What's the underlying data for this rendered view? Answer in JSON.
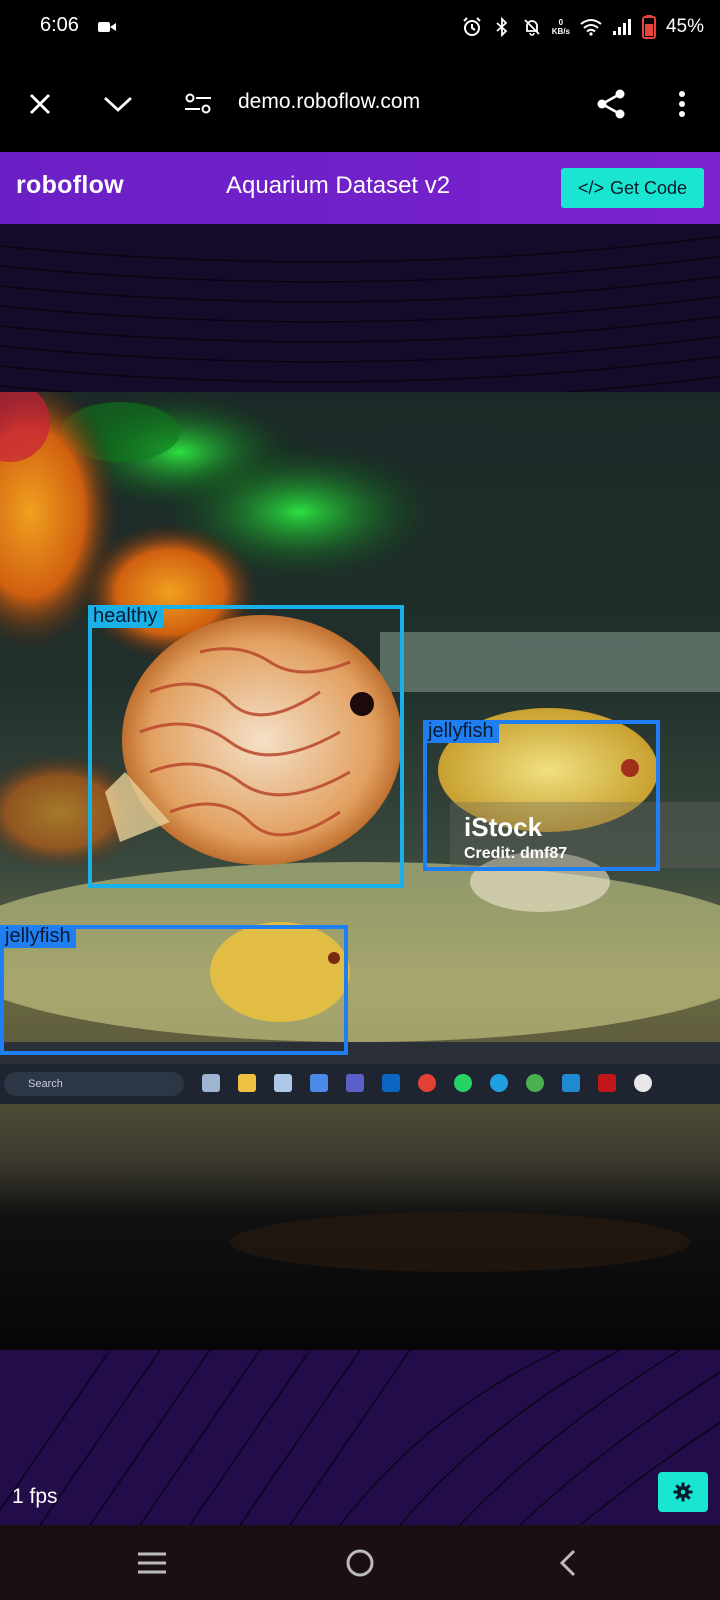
{
  "status_bar": {
    "time": "6:06",
    "network_speed_value": "0",
    "network_speed_unit": "KB/s",
    "battery_percent": "45%"
  },
  "browser": {
    "url": "demo.roboflow.com"
  },
  "header": {
    "logo": "roboflow",
    "title": "Aquarium Dataset v2",
    "get_code_label": "Get Code",
    "get_code_icon": "</>"
  },
  "detections": [
    {
      "label": "healthy",
      "color": "#1ab0e8"
    },
    {
      "label": "jellyfish",
      "color": "#1f7ef2"
    },
    {
      "label": "jellyfish",
      "color": "#1f7ef2"
    }
  ],
  "watermark": {
    "brand": "iStock",
    "credit": "Credit: dmf87"
  },
  "taskbar": {
    "search_placeholder": "Search"
  },
  "footer": {
    "fps": "1 fps"
  },
  "colors": {
    "accent": "#19e5d1",
    "header_purple": "#6a1fc4"
  }
}
